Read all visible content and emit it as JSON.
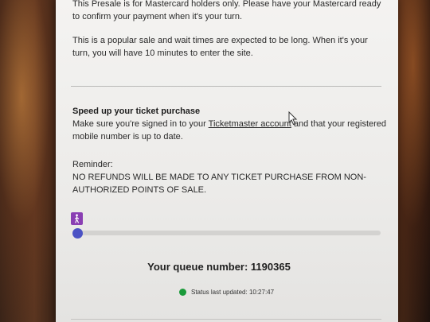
{
  "presale": {
    "line1": "This Presale is for Mastercard holders only. Please have your Mastercard ready to confirm your payment when it's your turn.",
    "line2": "This is a popular sale and wait times are expected to be long. When it's your turn, you will have 10 minutes to enter the site."
  },
  "speedup": {
    "heading": "Speed up your ticket purchase",
    "before_link": "Make sure you're signed in to your ",
    "link": "Ticketmaster account",
    "after_link": " and that your registered mobile number is up to date."
  },
  "reminder": {
    "heading": "Reminder:",
    "body": "NO REFUNDS WILL BE MADE TO ANY TICKET PURCHASE FROM NON-AUTHORIZED POINTS OF SALE."
  },
  "queue": {
    "label": "Your queue number: 1190365",
    "progress_fraction": 0.0
  },
  "status": {
    "text": "Status last updated: 10:27:47"
  },
  "colors": {
    "progress_accent": "#4b52c4",
    "status_ok": "#1a9a3a",
    "walker_bg": "#8a3fb3"
  }
}
